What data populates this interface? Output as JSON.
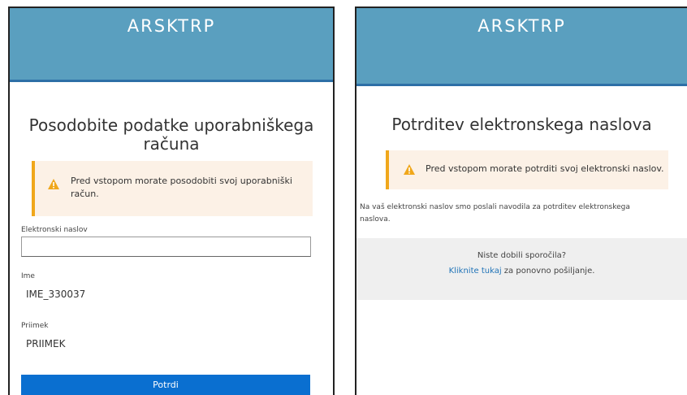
{
  "left": {
    "brand": "ARSKTRP",
    "title_line1": "Posodobite podatke uporabniškega",
    "title_line2": "računa",
    "alert_line1": "Pred vstopom morate posodobiti svoj uporabniški",
    "alert_line2": "račun.",
    "email_label": "Elektronski naslov",
    "email_value": "",
    "name_label": "Ime",
    "name_value": "IME_330037",
    "surname_label": "Priimek",
    "surname_value": "PRIIMEK",
    "submit_label": "Potrdi"
  },
  "right": {
    "brand": "ARSKTRP",
    "title": "Potrditev elektronskega naslova",
    "alert": "Pred vstopom morate potrditi svoj elektronski naslov.",
    "info_line1": "Na vaš elektronski naslov smo poslali navodila za potrditev elektronskega",
    "info_line2": "naslova.",
    "resend_question": "Niste dobili sporočila?",
    "resend_link": "Kliknite tukaj",
    "resend_suffix": " za ponovno pošiljanje."
  },
  "colors": {
    "header": "#5a9fbf",
    "header_border": "#2d6fa6",
    "alert_bg": "#fcf1e6",
    "alert_accent": "#f0a71b",
    "button": "#0a6fd0",
    "link": "#1f73b7"
  },
  "icons": [
    "warning-icon"
  ]
}
